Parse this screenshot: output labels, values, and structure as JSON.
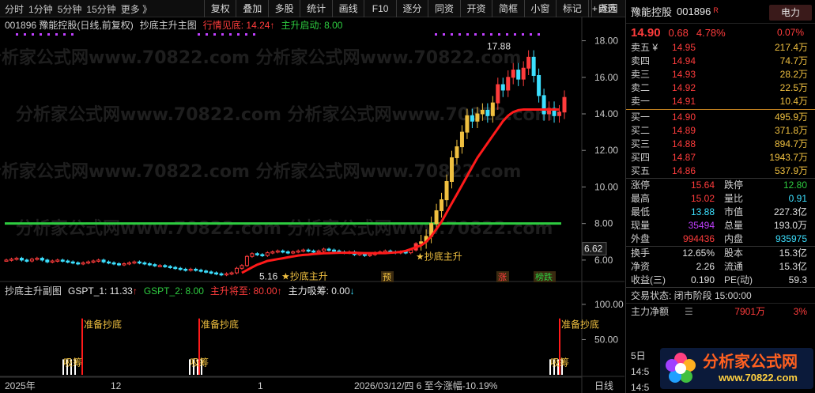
{
  "toolbar": {
    "left_items": [
      "分时",
      "1分钟",
      "5分钟",
      "15分钟",
      "更多 》"
    ],
    "buttons": [
      "复权",
      "叠加",
      "多股",
      "统计",
      "画线",
      "F10",
      "逐分",
      "同资",
      "开资",
      "简框",
      "小窗",
      "标记",
      "+自选"
    ],
    "back": "返回"
  },
  "main_legend": {
    "title": "001896 豫能控股(日线,前复权)",
    "indicator": "抄底主升主图",
    "line1": "行情见底: 14.24",
    "line1_arrow": "↑",
    "line2": "主升启动: 8.00"
  },
  "sub_legend": {
    "title": "抄底主升副图",
    "g1": "GSPT_1: 11.33",
    "g1_arrow": "↑",
    "g2": "GSPT_2: 8.00",
    "g3": "主升将至: 80.00",
    "g3_arrow": "↑",
    "g4": "主力吸筹: 0.00",
    "g4_arrow": "↓"
  },
  "watermark": "分析家公式网www.70822.com",
  "colors": {
    "up": "#ff3c3c",
    "down": "#3ce0ff",
    "green": "#2ecc40",
    "yellow": "#f0c040",
    "magenta": "#c040ff"
  },
  "chart_data": [
    {
      "type": "candlestick",
      "ylim": [
        5.0,
        18.5
      ],
      "yticks": [
        "18.00",
        "16.00",
        "14.00",
        "12.00",
        "10.00",
        "8.00",
        "6.00"
      ],
      "ytick_values": [
        18,
        16,
        14,
        12,
        10,
        8,
        6
      ],
      "current_price_label": "6.62",
      "horizontal_line": 8.0,
      "annotations": {
        "high": "17.88",
        "low": "5.16",
        "buy_label_1": "★抄底主升",
        "buy_label_2": "★抄底主升"
      },
      "markers": [
        "预",
        "涨",
        "榜跌"
      ],
      "candles_close": [
        6.0,
        6.05,
        6.1,
        6.0,
        5.95,
        6.05,
        6.1,
        6.0,
        5.9,
        5.95,
        6.0,
        5.95,
        5.9,
        5.85,
        5.8,
        5.85,
        5.9,
        5.95,
        6.0,
        5.9,
        5.85,
        5.8,
        5.75,
        5.8,
        5.85,
        5.9,
        5.85,
        5.8,
        5.75,
        5.7,
        5.7,
        5.65,
        5.6,
        5.55,
        5.5,
        5.45,
        5.5,
        5.45,
        5.4,
        5.35,
        5.3,
        5.25,
        5.2,
        5.25,
        5.3,
        5.55,
        5.7,
        6.2,
        6.35,
        6.3,
        6.25,
        6.4,
        6.45,
        6.5,
        6.45,
        6.4,
        6.45,
        6.5,
        6.55,
        6.5,
        6.45,
        6.5,
        6.6,
        6.55,
        6.5,
        6.45,
        6.4,
        6.45,
        6.3,
        6.35,
        6.25,
        6.3,
        6.4,
        6.45,
        6.5,
        6.45,
        6.4,
        6.45,
        6.4,
        6.55,
        6.9,
        7.0,
        7.3,
        8.0,
        8.7,
        9.3,
        10.3,
        11.6,
        12.2,
        13.0,
        13.9,
        13.6,
        14.0,
        14.2,
        13.9,
        14.6,
        15.6,
        15.3,
        16.0,
        16.4,
        15.9,
        16.5,
        17.1,
        16.1,
        15.0,
        14.0,
        14.3,
        13.9,
        14.1,
        14.9
      ],
      "ma_line_start": 46,
      "ma_values": [
        5.3,
        5.45,
        5.6,
        5.75,
        5.85,
        5.95,
        6.0,
        6.05,
        6.1,
        6.15,
        6.2,
        6.25,
        6.28,
        6.3,
        6.33,
        6.35,
        6.37,
        6.38,
        6.39,
        6.4,
        6.4,
        6.4,
        6.4,
        6.39,
        6.38,
        6.38,
        6.38,
        6.38,
        6.38,
        6.4,
        6.42,
        6.45,
        6.5,
        6.6,
        6.7,
        6.8,
        7.0,
        7.3,
        7.7,
        8.1,
        8.6,
        9.1,
        9.6,
        10.1,
        10.6,
        11.1,
        11.6,
        12.0,
        12.4,
        12.8,
        13.2,
        13.6,
        13.9,
        14.1,
        14.2,
        14.24,
        14.24,
        14.24,
        14.24,
        14.24,
        14.24,
        14.24,
        14.24
      ]
    },
    {
      "type": "bar",
      "ylim": [
        0,
        110
      ],
      "yticks": [
        "100.00",
        "50.00"
      ],
      "ytick_values": [
        100,
        50
      ],
      "signal_label_1": "准备抄底",
      "signal_label_2": "吸筹",
      "x_labels": [
        "2025年",
        "12",
        "1",
        "2026/03/12/四 6 至今涨幅-10.19%",
        "日线"
      ]
    }
  ],
  "panel": {
    "stock_name": "豫能控股",
    "stock_code": "001896",
    "stock_flag": "R",
    "sector": "电力",
    "price": "14.90",
    "change": "0.68",
    "pct": "4.78%",
    "sector_pct": "0.07%",
    "asks": [
      {
        "label": "卖五 ¥",
        "price": "14.95",
        "vol": "217.4万"
      },
      {
        "label": "卖四",
        "price": "14.94",
        "vol": "74.7万"
      },
      {
        "label": "卖三",
        "price": "14.93",
        "vol": "28.2万"
      },
      {
        "label": "卖二",
        "price": "14.92",
        "vol": "22.5万"
      },
      {
        "label": "卖一",
        "price": "14.91",
        "vol": "10.4万"
      }
    ],
    "bids": [
      {
        "label": "买一",
        "price": "14.90",
        "vol": "495.9万"
      },
      {
        "label": "买二",
        "price": "14.89",
        "vol": "371.8万"
      },
      {
        "label": "买三",
        "price": "14.88",
        "vol": "894.7万"
      },
      {
        "label": "买四",
        "price": "14.87",
        "vol": "1943.7万"
      },
      {
        "label": "买五",
        "price": "14.86",
        "vol": "537.9万"
      }
    ],
    "stats": [
      {
        "k": "涨停",
        "v": "15.64",
        "vc": "red",
        "k2": "跌停",
        "v2": "12.80",
        "v2c": "grn"
      },
      {
        "k": "最高",
        "v": "15.02",
        "vc": "red",
        "k2": "量比",
        "v2": "0.91",
        "v2c": "cyn"
      },
      {
        "k": "最低",
        "v": "13.88",
        "vc": "cyn",
        "k2": "市值",
        "v2": "227.3亿",
        "v2c": "wht"
      },
      {
        "k": "现量",
        "v": "35494",
        "vc": "pur",
        "k2": "总量",
        "v2": "193.0万",
        "v2c": "wht"
      },
      {
        "k": "外盘",
        "v": "994436",
        "vc": "red",
        "k2": "内盘",
        "v2": "935975",
        "v2c": "cyn"
      }
    ],
    "stats2": [
      {
        "k": "换手",
        "v": "12.65%",
        "k2": "股本",
        "v2": "15.3亿"
      },
      {
        "k": "净资",
        "v": "2.26",
        "k2": "流通",
        "v2": "15.3亿"
      },
      {
        "k": "收益(三)",
        "v": "0.190",
        "k2": "PE(动)",
        "v2": "59.3"
      }
    ],
    "trade_status": "交易状态: 闭市阶段 15:00:00",
    "netflow_label": "主力净额",
    "netflow_value": "7901万",
    "netflow_pct": "3%",
    "stub1": "5日",
    "stub2": "14:5",
    "stub3": "14:5"
  },
  "logo": {
    "text": "分析家公式网",
    "url": "www.70822.com"
  }
}
